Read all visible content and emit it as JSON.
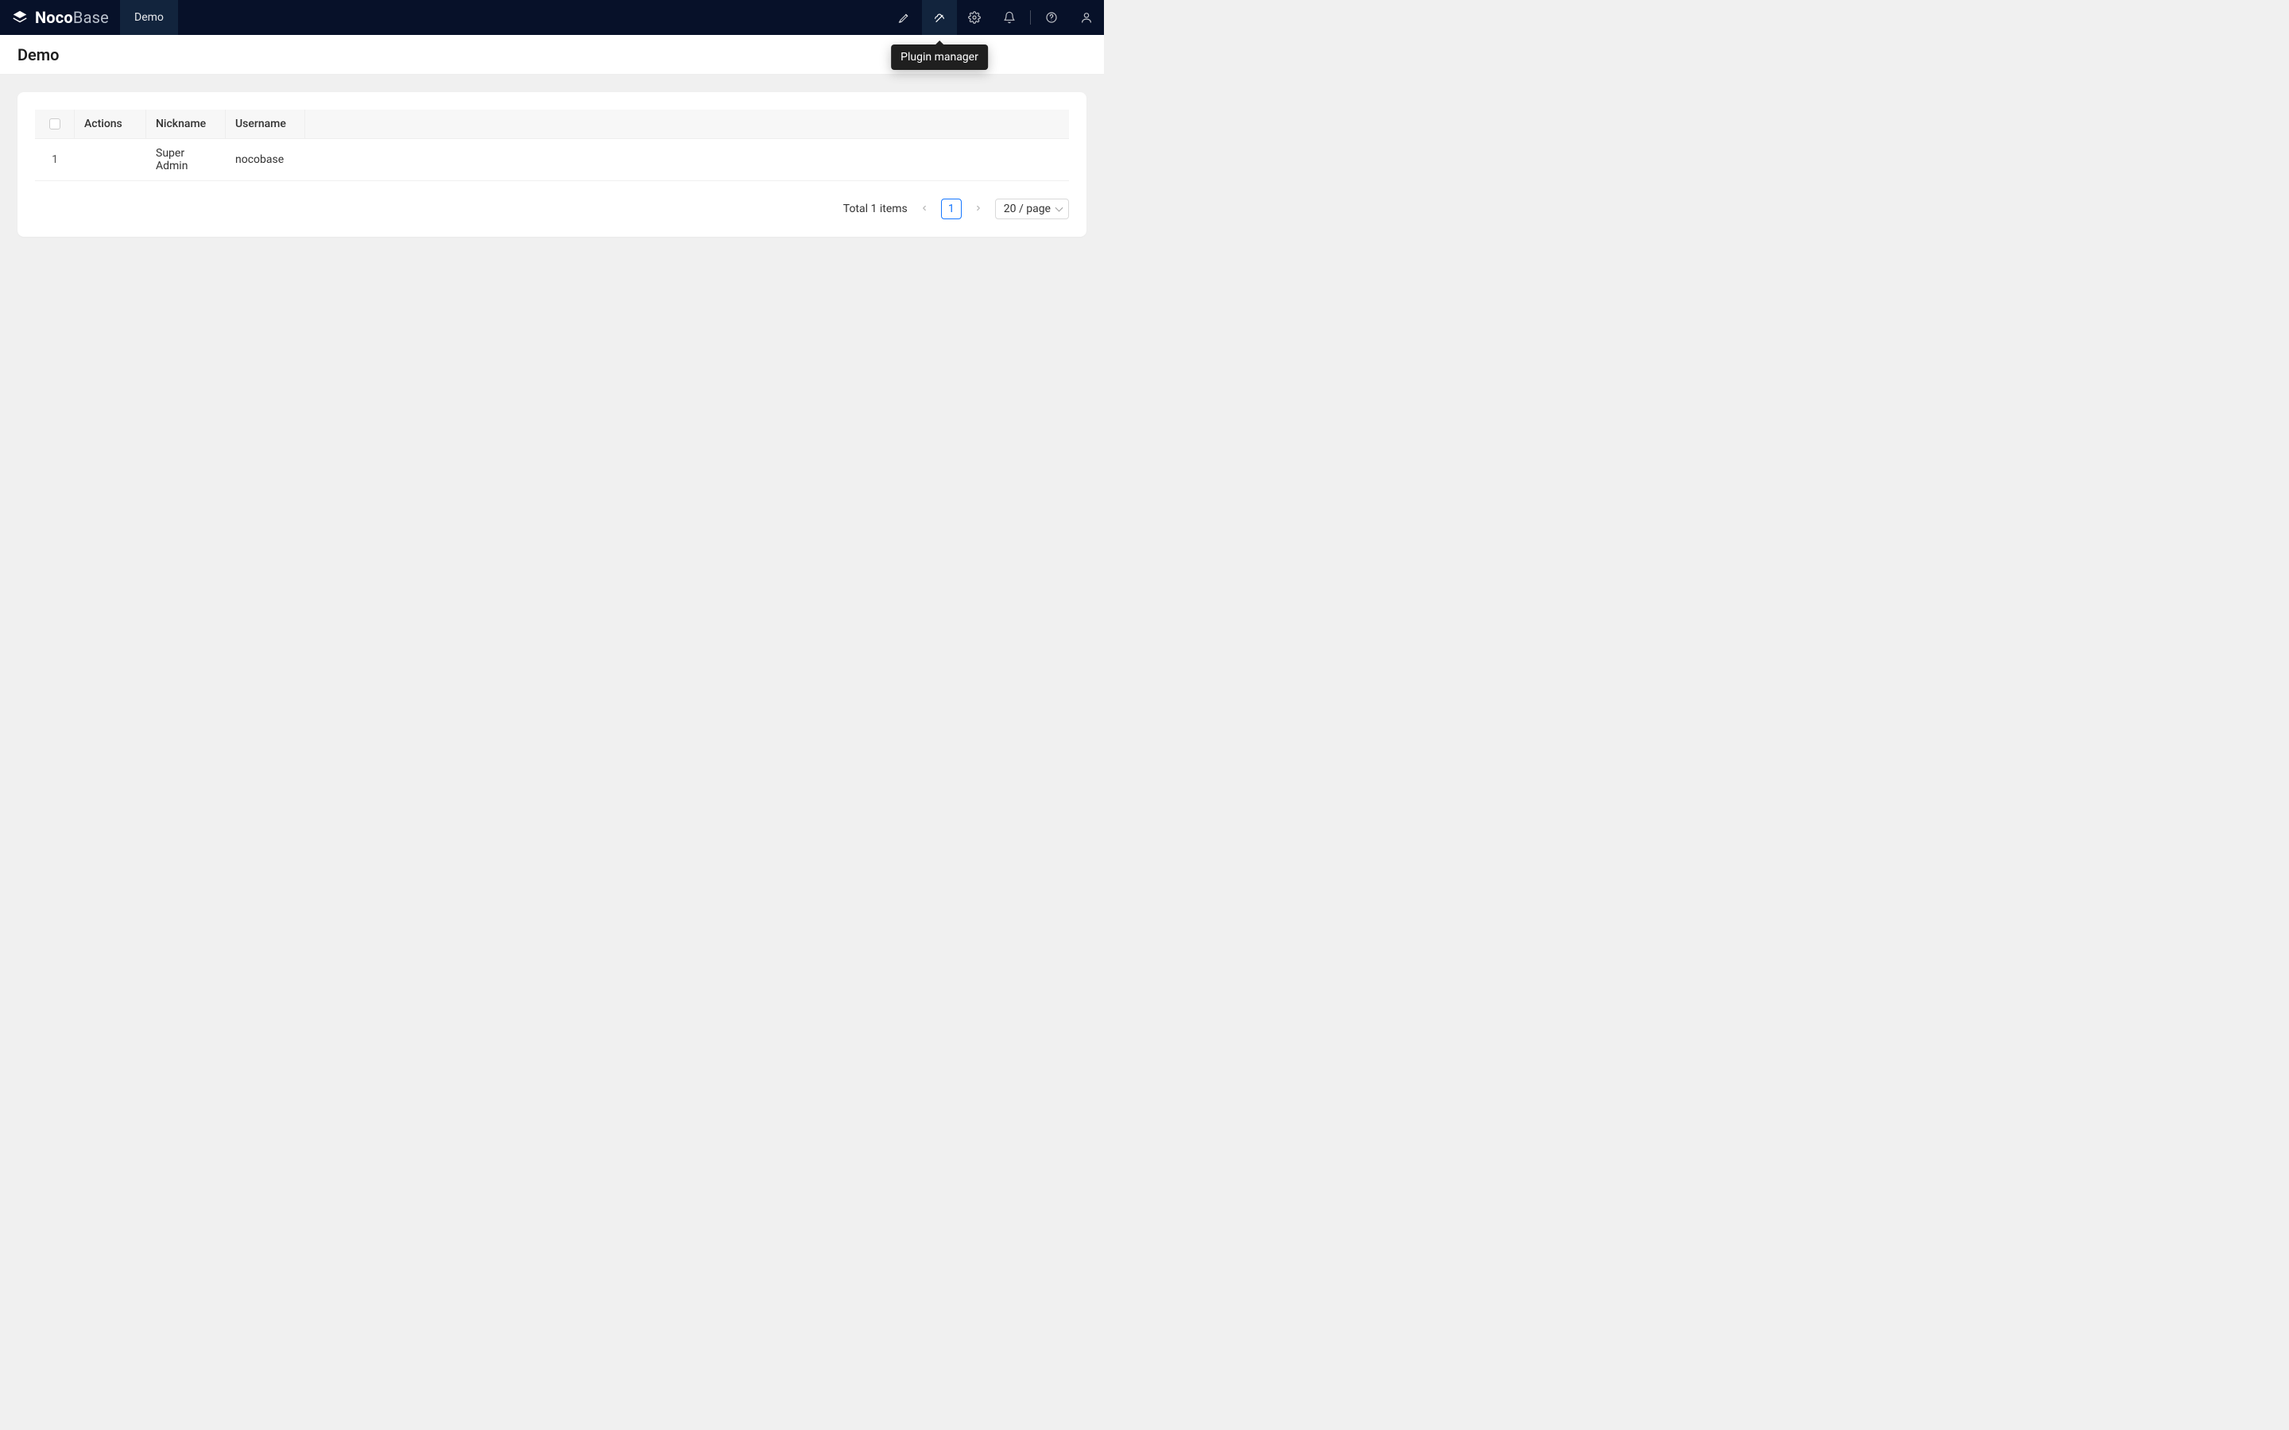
{
  "brand": {
    "name_bold": "Noco",
    "name_light": "Base"
  },
  "nav": {
    "tab_label": "Demo"
  },
  "tooltip": {
    "plugin_manager": "Plugin manager"
  },
  "page": {
    "title": "Demo"
  },
  "table": {
    "headers": {
      "actions": "Actions",
      "nickname": "Nickname",
      "username": "Username"
    },
    "rows": [
      {
        "index": "1",
        "actions": "",
        "nickname": "Super Admin",
        "username": "nocobase"
      }
    ]
  },
  "pagination": {
    "total_text": "Total 1 items",
    "current_page": "1",
    "page_size_label": "20 / page"
  }
}
